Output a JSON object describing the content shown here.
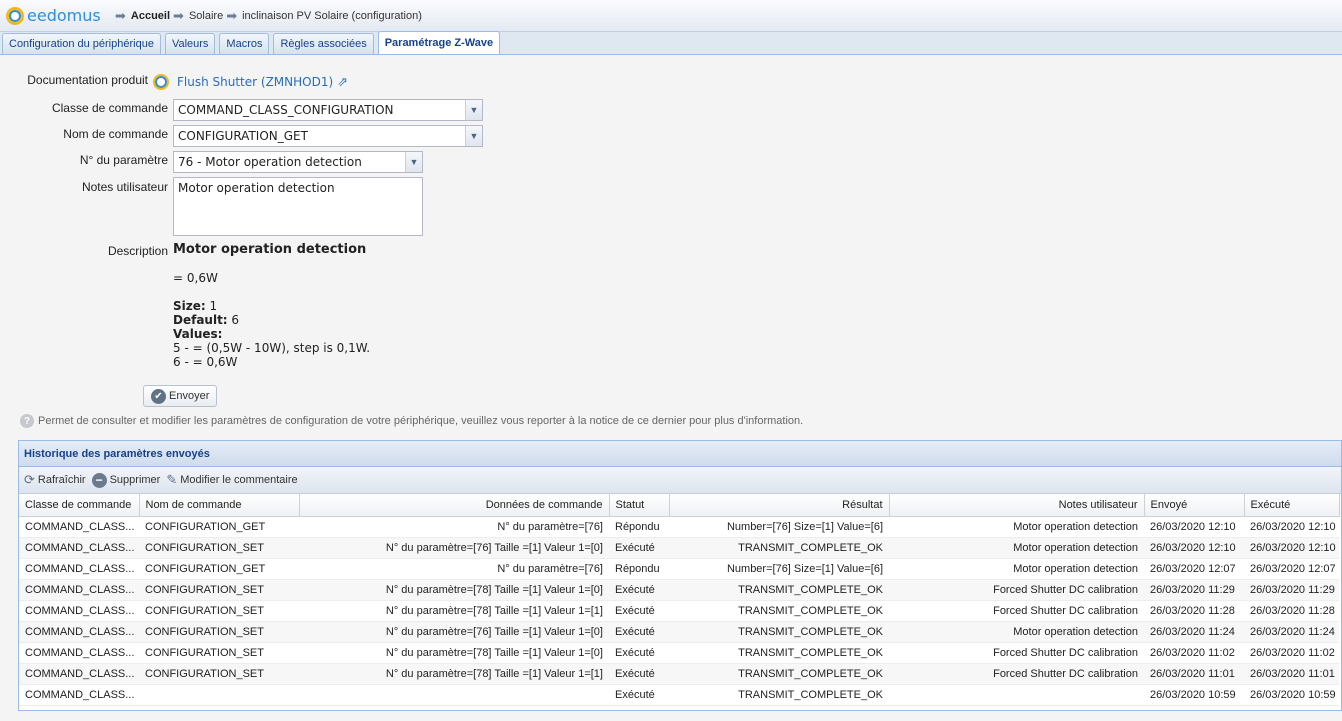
{
  "brand": {
    "name": "eedomus"
  },
  "breadcrumb": [
    "Accueil",
    "Solaire",
    "inclinaison PV Solaire (configuration)"
  ],
  "tabs": [
    {
      "label": "Configuration du périphérique",
      "active": false
    },
    {
      "label": "Valeurs",
      "active": false
    },
    {
      "label": "Macros",
      "active": false
    },
    {
      "label": "Règles associées",
      "active": false
    },
    {
      "label": "Paramétrage Z-Wave",
      "active": true
    }
  ],
  "form": {
    "doc_label": "Documentation produit",
    "doc_link": "Flush Shutter (ZMNHOD1)",
    "classe_label": "Classe de commande",
    "classe_value": "COMMAND_CLASS_CONFIGURATION",
    "nom_label": "Nom de commande",
    "nom_value": "CONFIGURATION_GET",
    "param_label": "N° du paramètre",
    "param_value": "76 - Motor operation detection",
    "notes_label": "Notes utilisateur",
    "notes_value": "Motor operation detection",
    "desc_label": "Description",
    "desc_title": "Motor operation detection",
    "desc_line1": "= 0,6W",
    "size_label": "Size:",
    "size_value": " 1",
    "default_label": "Default:",
    "default_value": " 6",
    "values_label": "Values:",
    "value_5": "5 - = (0,5W - 10W), step is 0,1W.",
    "value_6": "6 - = 0,6W",
    "send_label": "Envoyer"
  },
  "info_text": "Permet de consulter et modifier les paramètres de configuration de votre périphérique, veuillez vous reporter à la notice de ce dernier pour plus d'information.",
  "history": {
    "title": "Historique des paramètres envoyés",
    "toolbar": {
      "refresh": "Rafraîchir",
      "delete": "Supprimer",
      "edit_comment": "Modifier le commentaire"
    },
    "columns": [
      "Classe de commande",
      "Nom de commande",
      "Données de commande",
      "Statut",
      "Résultat",
      "Notes utilisateur",
      "Envoyé",
      "Exécuté"
    ],
    "rows": [
      [
        "COMMAND_CLASS...",
        "CONFIGURATION_GET",
        "N° du paramètre=[76]",
        "Répondu",
        "Number=[76] Size=[1] Value=[6]",
        "Motor operation detection",
        "26/03/2020 12:10",
        "26/03/2020 12:10"
      ],
      [
        "COMMAND_CLASS...",
        "CONFIGURATION_SET",
        "N° du paramètre=[76] Taille =[1] Valeur 1=[0]",
        "Exécuté",
        "TRANSMIT_COMPLETE_OK",
        "Motor operation detection",
        "26/03/2020 12:10",
        "26/03/2020 12:10"
      ],
      [
        "COMMAND_CLASS...",
        "CONFIGURATION_GET",
        "N° du paramètre=[76]",
        "Répondu",
        "Number=[76] Size=[1] Value=[6]",
        "Motor operation detection",
        "26/03/2020 12:07",
        "26/03/2020 12:07"
      ],
      [
        "COMMAND_CLASS...",
        "CONFIGURATION_SET",
        "N° du paramètre=[78] Taille =[1] Valeur 1=[0]",
        "Exécuté",
        "TRANSMIT_COMPLETE_OK",
        "Forced Shutter DC calibration",
        "26/03/2020 11:29",
        "26/03/2020 11:29"
      ],
      [
        "COMMAND_CLASS...",
        "CONFIGURATION_SET",
        "N° du paramètre=[78] Taille =[1] Valeur 1=[1]",
        "Exécuté",
        "TRANSMIT_COMPLETE_OK",
        "Forced Shutter DC calibration",
        "26/03/2020 11:28",
        "26/03/2020 11:28"
      ],
      [
        "COMMAND_CLASS...",
        "CONFIGURATION_SET",
        "N° du paramètre=[76] Taille =[1] Valeur 1=[0]",
        "Exécuté",
        "TRANSMIT_COMPLETE_OK",
        "Motor operation detection",
        "26/03/2020 11:24",
        "26/03/2020 11:24"
      ],
      [
        "COMMAND_CLASS...",
        "CONFIGURATION_SET",
        "N° du paramètre=[78] Taille =[1] Valeur 1=[0]",
        "Exécuté",
        "TRANSMIT_COMPLETE_OK",
        "Forced Shutter DC calibration",
        "26/03/2020 11:02",
        "26/03/2020 11:02"
      ],
      [
        "COMMAND_CLASS...",
        "CONFIGURATION_SET",
        "N° du paramètre=[78] Taille =[1] Valeur 1=[1]",
        "Exécuté",
        "TRANSMIT_COMPLETE_OK",
        "Forced Shutter DC calibration",
        "26/03/2020 11:01",
        "26/03/2020 11:01"
      ],
      [
        "COMMAND_CLASS...",
        "",
        "",
        "Exécuté",
        "TRANSMIT_COMPLETE_OK",
        "",
        "26/03/2020 10:59",
        "26/03/2020 10:59"
      ]
    ]
  }
}
